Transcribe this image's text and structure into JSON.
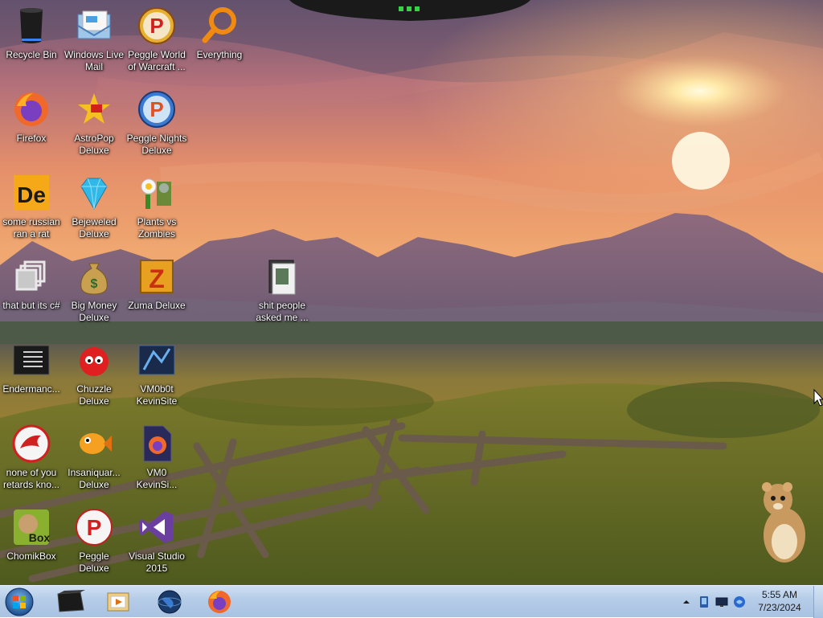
{
  "desktop": {
    "icons": [
      {
        "id": "recycle-bin",
        "label": "Recycle Bin",
        "icon": "recycle-bin-icon"
      },
      {
        "id": "windows-live-mail",
        "label": "Windows Live Mail",
        "icon": "mail-icon"
      },
      {
        "id": "peggle-world-of-warcraft",
        "label": "Peggle World of Warcraft ...",
        "icon": "peggle-icon"
      },
      {
        "id": "everything",
        "label": "Everything",
        "icon": "magnifier-icon"
      },
      {
        "id": "firefox",
        "label": "Firefox",
        "icon": "firefox-icon"
      },
      {
        "id": "astropop-deluxe",
        "label": "AstroPop Deluxe",
        "icon": "astropop-icon"
      },
      {
        "id": "peggle-nights-deluxe",
        "label": "Peggle Nights Deluxe",
        "icon": "peggle-nights-icon"
      },
      {
        "id": "some-russian-ran-a-rat",
        "label": "some russian ran a rat",
        "icon": "de-icon"
      },
      {
        "id": "bejeweled-deluxe",
        "label": "Bejeweled Deluxe",
        "icon": "gem-icon"
      },
      {
        "id": "plants-vs-zombies",
        "label": "Plants vs Zombies",
        "icon": "plant-icon"
      },
      {
        "id": "that-but-its-csharp",
        "label": "that but its c#",
        "icon": "copy-windows-icon"
      },
      {
        "id": "big-money-deluxe",
        "label": "Big Money Deluxe",
        "icon": "money-bag-icon"
      },
      {
        "id": "zuma-deluxe",
        "label": "Zuma Deluxe",
        "icon": "zuma-icon"
      },
      {
        "id": "shit-people-asked-me",
        "label": "shit people asked me ...",
        "icon": "folder-icon"
      },
      {
        "id": "endermanch",
        "label": "Endermanc...",
        "icon": "console-icon"
      },
      {
        "id": "chuzzle-deluxe",
        "label": "Chuzzle Deluxe",
        "icon": "chuzzle-icon"
      },
      {
        "id": "vm0b0t-kevinsite",
        "label": "VM0b0t KevinSite",
        "icon": "vm-app-icon"
      },
      {
        "id": "none-of-you-retards",
        "label": "none of you retards kno...",
        "icon": "red-fox-icon"
      },
      {
        "id": "insaniquarium-deluxe",
        "label": "Insaniquar... Deluxe",
        "icon": "fish-icon"
      },
      {
        "id": "vm0-kevinsite",
        "label": "VM0 KevinSi...",
        "icon": "firefox-file-icon"
      },
      {
        "id": "chomikbox",
        "label": "ChomikBox",
        "icon": "hamster-box-icon"
      },
      {
        "id": "peggle-deluxe",
        "label": "Peggle Deluxe",
        "icon": "peggle-icon"
      },
      {
        "id": "visual-studio-2015",
        "label": "Visual Studio 2015",
        "icon": "visual-studio-icon"
      }
    ]
  },
  "taskbar": {
    "start_button": {
      "icon": "windows-orb-icon"
    },
    "pinned": [
      {
        "id": "terminal-box",
        "icon": "black-box-icon"
      },
      {
        "id": "media-folder",
        "icon": "media-folder-icon"
      },
      {
        "id": "globe",
        "icon": "globe-icon"
      },
      {
        "id": "firefox",
        "icon": "firefox-icon"
      }
    ],
    "tray": {
      "icons": [
        "show-hidden-icons-arrow-icon",
        "phone-icon",
        "monitor-icon",
        "network-icon"
      ]
    },
    "clock": {
      "time": "5:55 AM",
      "date": "7/23/2024"
    }
  },
  "colors": {
    "taskbar_top": "#cfe0f3",
    "taskbar_bottom": "#a8c2e2",
    "sky_top": "#6b5a78",
    "sun": "#fff6c8",
    "grass": "#8a8a2a"
  }
}
